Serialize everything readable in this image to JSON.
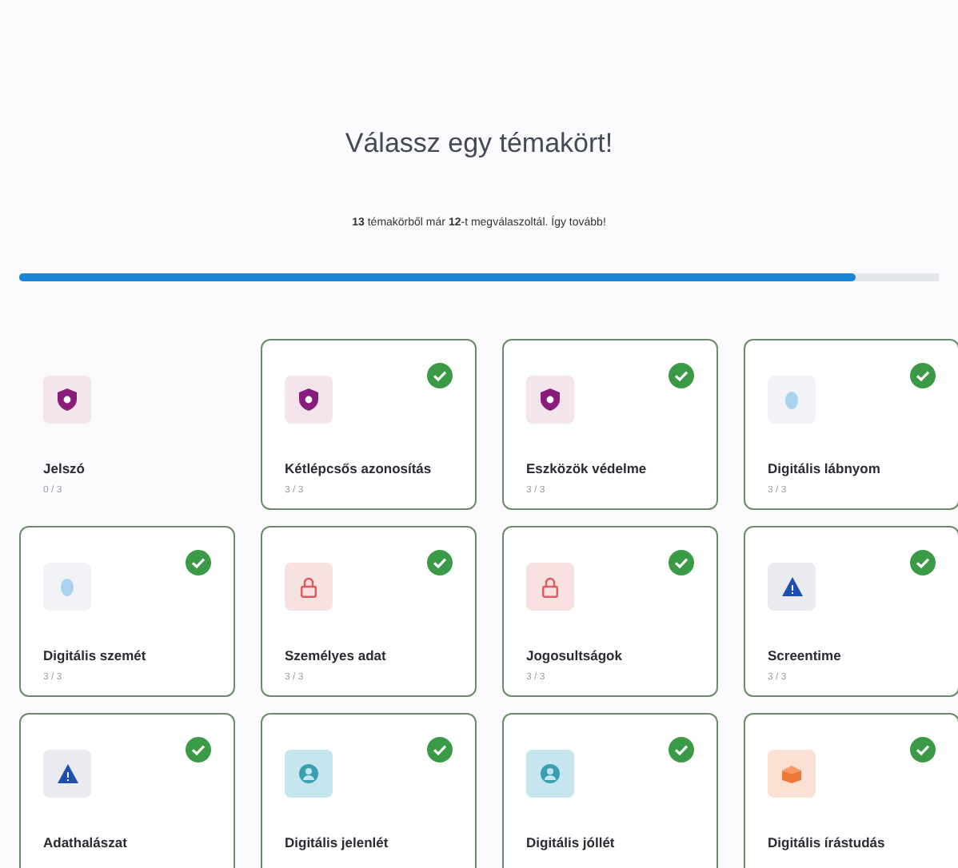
{
  "title": "Válassz egy témakört!",
  "summary": "**13** témakörből már **12**-t megválaszoltál. Így tovább!",
  "progress": {
    "level": 0.91
  },
  "topics": [
    {
      "title": "Jelszó",
      "progress": "0 / 3",
      "kind": "shield",
      "completed": false
    },
    {
      "title": "Kétlépcsős azonosítás",
      "progress": "3 / 3",
      "kind": "shield",
      "completed": true
    },
    {
      "title": "Eszközök védelme",
      "progress": "3 / 3",
      "kind": "shield",
      "completed": true
    },
    {
      "title": "Digitális lábnyom",
      "progress": "3 / 3",
      "kind": "drop",
      "completed": true
    },
    {
      "title": "Digitális szemét",
      "progress": "3 / 3",
      "kind": "drop",
      "completed": true
    },
    {
      "title": "Személyes adat",
      "progress": "3 / 3",
      "kind": "lock",
      "completed": true
    },
    {
      "title": "Jogosultságok",
      "progress": "3 / 3",
      "kind": "lock",
      "completed": true
    },
    {
      "title": "Screentime",
      "progress": "3 / 3",
      "kind": "warning",
      "completed": true
    },
    {
      "title": "Adathalászat",
      "kind": "warning",
      "completed": true
    },
    {
      "title": "Digitális jelenlét",
      "kind": "person",
      "completed": true
    },
    {
      "title": "Digitális jóllét",
      "kind": "person",
      "completed": true
    },
    {
      "title": "Digitális írástudás",
      "kind": "box",
      "completed": true
    }
  ]
}
